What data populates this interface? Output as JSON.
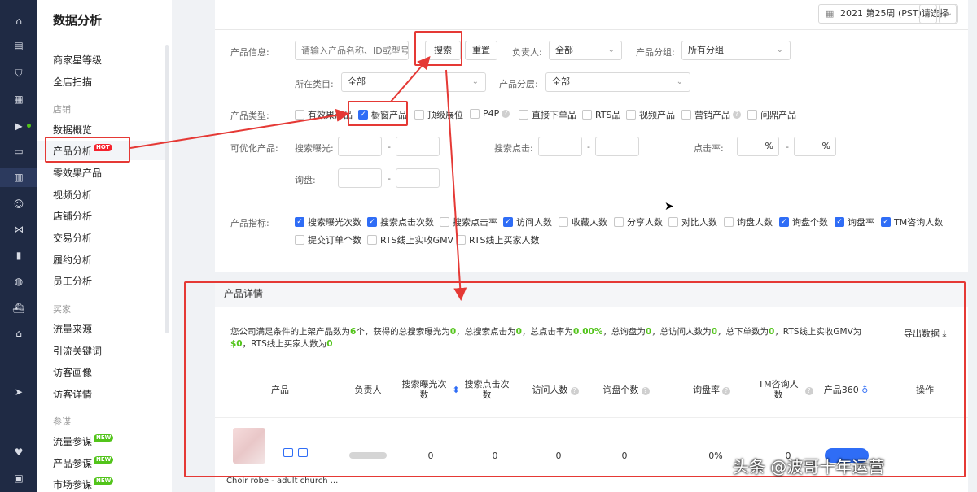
{
  "rail": {
    "icons": [
      "home-icon",
      "store-icon",
      "shield-icon",
      "apps-icon",
      "video-icon",
      "chat-icon",
      "chart-icon",
      "users-icon",
      "share-icon",
      "clipboard-icon",
      "globe-icon",
      "ship-icon",
      "bank-icon",
      "send-icon",
      "heart-icon",
      "briefcase-icon"
    ]
  },
  "nav": {
    "title": "数据分析",
    "items_top": [
      "商家星等级",
      "全店扫描"
    ],
    "group_store": "店铺",
    "store_items": [
      "数据概览",
      "产品分析",
      "零效果产品",
      "视频分析",
      "店铺分析",
      "交易分析",
      "履约分析",
      "员工分析"
    ],
    "hot": "HOT",
    "group_buyer": "买家",
    "buyer_items": [
      "流量来源",
      "引流关键词",
      "访客画像",
      "访客详情"
    ],
    "group_advisor": "参谋",
    "advisor_items": [
      "流量参谋",
      "产品参谋",
      "市场参谋"
    ],
    "new": "NEW"
  },
  "topbar": {
    "date": "2021 第25周 (PST)请选择",
    "prev": "‹",
    "next": "›"
  },
  "filter": {
    "product_info_label": "产品信息:",
    "product_info_placeholder": "请输入产品名称、ID或型号",
    "search_btn": "搜索",
    "reset_btn": "重置",
    "owner_label": "负责人:",
    "owner_value": "全部",
    "group_label": "产品分组:",
    "group_value": "所有分组",
    "category_label": "所在类目:",
    "category_value": "全部",
    "tier_label": "产品分层:",
    "tier_value": "全部",
    "type_label": "产品类型:",
    "types": [
      {
        "label": "有效果产品",
        "checked": false
      },
      {
        "label": "橱窗产品",
        "checked": true
      },
      {
        "label": "顶级展位",
        "checked": false
      },
      {
        "label": "P4P",
        "checked": false
      },
      {
        "label": "直接下单品",
        "checked": false
      },
      {
        "label": "RTS品",
        "checked": false
      },
      {
        "label": "视频产品",
        "checked": false
      },
      {
        "label": "营销产品",
        "checked": false
      },
      {
        "label": "问鼎产品",
        "checked": false
      }
    ],
    "optimizable_label": "可优化产品:",
    "exposure_label": "搜索曝光:",
    "clicks_label": "搜索点击:",
    "ctr_label": "点击率:",
    "inquiry_label": "询盘:",
    "dash": "-",
    "pct": "%",
    "metrics_label": "产品指标:",
    "metrics": [
      {
        "label": "搜索曝光次数",
        "checked": true
      },
      {
        "label": "搜索点击次数",
        "checked": true
      },
      {
        "label": "搜索点击率",
        "checked": false
      },
      {
        "label": "访问人数",
        "checked": true
      },
      {
        "label": "收藏人数",
        "checked": false
      },
      {
        "label": "分享人数",
        "checked": false
      },
      {
        "label": "对比人数",
        "checked": false
      },
      {
        "label": "询盘人数",
        "checked": false
      },
      {
        "label": "询盘个数",
        "checked": true
      },
      {
        "label": "询盘率",
        "checked": true
      },
      {
        "label": "TM咨询人数",
        "checked": true
      },
      {
        "label": "提交订单个数",
        "checked": false
      },
      {
        "label": "RTS线上实收GMV",
        "checked": false
      },
      {
        "label": "RTS线上买家人数",
        "checked": false
      }
    ],
    "check": "✓"
  },
  "details": {
    "title": "产品详情",
    "summary": {
      "p1": "您公司满足条件的上架产品数为",
      "v1": "6",
      "p2": "个，获得的总搜索曝光为",
      "v2": "0",
      "p3": "，总搜索点击为",
      "v3": "0",
      "p4": "，总点击率为",
      "v4": "0.00%",
      "p5": "，总询盘为",
      "v5": "0",
      "p6": "，总访问人数为",
      "v6": "0",
      "p7": "，总下单数为",
      "v7": "0",
      "p8": "，RTS线上实收GMV为",
      "v8": "$0",
      "p9": "，RTS线上买家人数为",
      "v9": "0"
    },
    "export": "导出数据",
    "columns": [
      "产品",
      "负责人",
      "搜索曝光次数",
      "搜索点击次数",
      "访问人数",
      "询盘个数",
      "询盘率",
      "TM咨询人数",
      "产品360",
      "操作"
    ],
    "row": {
      "exposure": "0",
      "clicks": "0",
      "visitors": "0",
      "inquiries": "0",
      "rate": "0%",
      "tm": "0",
      "name": "Choir robe - adult church ..."
    }
  },
  "watermark": "头条 @波哥十年运营"
}
